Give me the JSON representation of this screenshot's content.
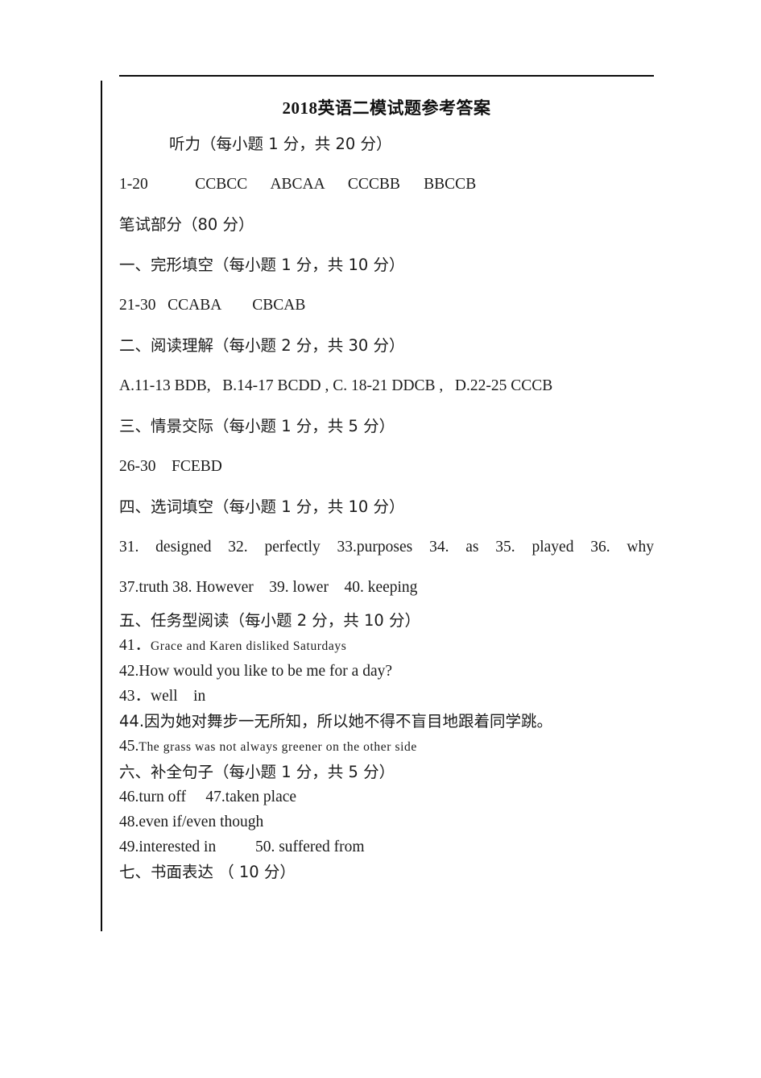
{
  "document": {
    "title": "2018英语二模试题参考答案",
    "title_year": "2018",
    "title_rest": "英语二模试题参考答案"
  },
  "sections": {
    "listening_heading": "听力（每小题 1 分，共 20 分）",
    "listening_answers": "1-20            CCBCC      ABCAA      CCCBB      BBCCB",
    "written_part_heading": "笔试部分（80 分）",
    "cloze_heading": "一、完形填空（每小题 1 分，共 10 分）",
    "cloze_answers": "21-30   CCABA        CBCAB",
    "reading_heading": "二、阅读理解（每小题 2 分，共 30 分）",
    "reading_answers": "A.11-13 BDB,   B.14-17 BCDD , C. 18-21 DDCB ,   D.22-25 CCCB",
    "situational_heading": "三、情景交际（每小题 1 分，共 5 分）",
    "situational_answers": "26-30    FCEBD",
    "word_fill_heading": "四、选词填空（每小题 1 分，共 10 分）",
    "word_fill_answers_line1": "31. designed   32. perfectly   33.purposes 34. as 35. played 36. why",
    "word_fill_answers_line2": "37.truth 38. However    39. lower    40. keeping",
    "task_reading_heading": "五、任务型阅读（每小题 2 分，共 10 分）",
    "task_41_num": "41．",
    "task_41_text": "Grace and Karen disliked Saturdays",
    "task_42": "42.How would you like to be me for a day?",
    "task_43": "43．well    in",
    "task_44": "44.因为她对舞步一无所知，所以她不得不盲目地跟着同学跳。",
    "task_45_num": "45.",
    "task_45_text": "The grass was not always greener on the other side",
    "complete_sentence_heading": "六、补全句子（每小题 1 分，共 5 分）",
    "sentence_46_47": "46.turn off     47.taken place",
    "sentence_48": "48.even if/even though",
    "sentence_49_50": "49.interested in          50. suffered from",
    "writing_heading": "七、书面表达 （ 10 分）"
  }
}
